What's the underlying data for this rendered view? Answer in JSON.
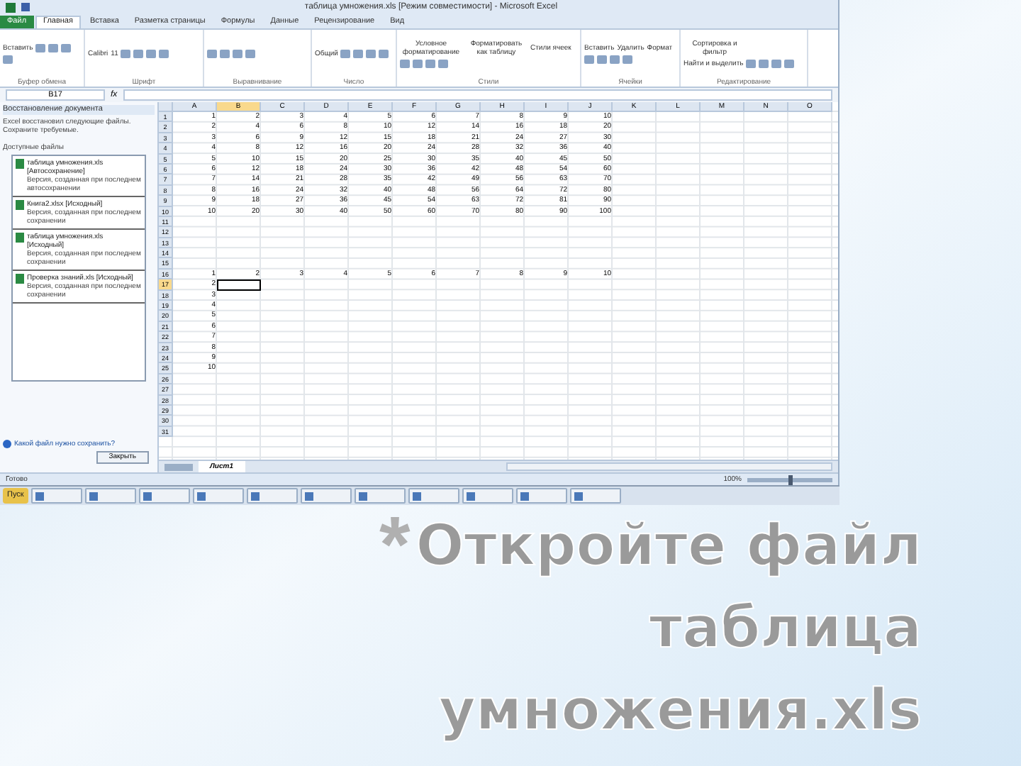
{
  "slide": {
    "bullet": "*",
    "title_lines": [
      "Откройте файл",
      "таблица",
      "умножения.xls"
    ]
  },
  "excel": {
    "title": "таблица умножения.xls [Режим совместимости] - Microsoft Excel",
    "ribbon_tabs": [
      {
        "label": "Файл",
        "selected": false,
        "kind": "file"
      },
      {
        "label": "Главная",
        "selected": true
      },
      {
        "label": "Вставка",
        "selected": false
      },
      {
        "label": "Разметка страницы",
        "selected": false
      },
      {
        "label": "Формулы",
        "selected": false
      },
      {
        "label": "Данные",
        "selected": false
      },
      {
        "label": "Рецензирование",
        "selected": false
      },
      {
        "label": "Вид",
        "selected": false
      }
    ],
    "ribbon_groups": [
      {
        "label": "Буфер обмена",
        "buttons": [
          "Вставить"
        ]
      },
      {
        "label": "Шрифт",
        "buttons": [
          "Calibri",
          "11"
        ]
      },
      {
        "label": "Выравнивание"
      },
      {
        "label": "Число",
        "buttons": [
          "Общий"
        ]
      },
      {
        "label": "Стили",
        "buttons": [
          "Условное форматирование",
          "Форматировать как таблицу",
          "Стили ячеек"
        ]
      },
      {
        "label": "Ячейки",
        "buttons": [
          "Вставить",
          "Удалить",
          "Формат"
        ]
      },
      {
        "label": "Редактирование",
        "buttons": [
          "Сортировка и фильтр",
          "Найти и выделить"
        ]
      }
    ],
    "name_box": "B17",
    "formula_symbol": "fx",
    "recovery_pane": {
      "title": "Восстановление документа",
      "message": "Excel восстановил следующие файлы. Сохраните требуемые.",
      "list_label": "Доступные файлы",
      "files": [
        {
          "name": "таблица умножения.xls [Автосохранение]",
          "version": "Версия, созданная при последнем автосохранении"
        },
        {
          "name": "Книга2.xlsx [Исходный]",
          "version": "Версия, созданная при последнем сохранении"
        },
        {
          "name": "таблица умножения.xls [Исходный]",
          "version": "Версия, созданная при последнем сохранении"
        },
        {
          "name": "Проверка знаний.xls [Исходный]",
          "version": "Версия, созданная при последнем сохранении"
        }
      ],
      "help_link": "Какой файл нужно сохранить?",
      "close_button": "Закрыть"
    },
    "columns": [
      {
        "label": "A",
        "selected": false
      },
      {
        "label": "B",
        "selected": true
      },
      {
        "label": "C",
        "selected": false
      },
      {
        "label": "D",
        "selected": false
      },
      {
        "label": "E",
        "selected": false
      },
      {
        "label": "F",
        "selected": false
      },
      {
        "label": "G",
        "selected": false
      },
      {
        "label": "H",
        "selected": false
      },
      {
        "label": "I",
        "selected": false
      },
      {
        "label": "J",
        "selected": false
      },
      {
        "label": "K",
        "selected": false
      },
      {
        "label": "L",
        "selected": false
      },
      {
        "label": "M",
        "selected": false
      },
      {
        "label": "N",
        "selected": false
      },
      {
        "label": "O",
        "selected": false
      }
    ],
    "rows": [
      {
        "number": "1",
        "selected": false,
        "cells": [
          "1",
          "2",
          "3",
          "4",
          "5",
          "6",
          "7",
          "8",
          "9",
          "10"
        ]
      },
      {
        "number": "2",
        "selected": false,
        "cells": [
          "2",
          "4",
          "6",
          "8",
          "10",
          "12",
          "14",
          "16",
          "18",
          "20"
        ]
      },
      {
        "number": "3",
        "selected": false,
        "cells": [
          "3",
          "6",
          "9",
          "12",
          "15",
          "18",
          "21",
          "24",
          "27",
          "30"
        ]
      },
      {
        "number": "4",
        "selected": false,
        "cells": [
          "4",
          "8",
          "12",
          "16",
          "20",
          "24",
          "28",
          "32",
          "36",
          "40"
        ]
      },
      {
        "number": "5",
        "selected": false,
        "cells": [
          "5",
          "10",
          "15",
          "20",
          "25",
          "30",
          "35",
          "40",
          "45",
          "50"
        ]
      },
      {
        "number": "6",
        "selected": false,
        "cells": [
          "6",
          "12",
          "18",
          "24",
          "30",
          "36",
          "42",
          "48",
          "54",
          "60"
        ]
      },
      {
        "number": "7",
        "selected": false,
        "cells": [
          "7",
          "14",
          "21",
          "28",
          "35",
          "42",
          "49",
          "56",
          "63",
          "70"
        ]
      },
      {
        "number": "8",
        "selected": false,
        "cells": [
          "8",
          "16",
          "24",
          "32",
          "40",
          "48",
          "56",
          "64",
          "72",
          "80"
        ]
      },
      {
        "number": "9",
        "selected": false,
        "cells": [
          "9",
          "18",
          "27",
          "36",
          "45",
          "54",
          "63",
          "72",
          "81",
          "90"
        ]
      },
      {
        "number": "10",
        "selected": false,
        "cells": [
          "10",
          "20",
          "30",
          "40",
          "50",
          "60",
          "70",
          "80",
          "90",
          "100"
        ]
      },
      {
        "number": "11",
        "selected": false
      },
      {
        "number": "12",
        "selected": false
      },
      {
        "number": "13",
        "selected": false
      },
      {
        "number": "14",
        "selected": false
      },
      {
        "number": "15",
        "selected": false
      },
      {
        "number": "16",
        "selected": false,
        "cells": [
          "1",
          "2",
          "3",
          "4",
          "5",
          "6",
          "7",
          "8",
          "9",
          "10"
        ]
      },
      {
        "number": "17",
        "selected": true,
        "cells": [
          "2"
        ]
      },
      {
        "number": "18",
        "selected": false,
        "cells": [
          "3"
        ]
      },
      {
        "number": "19",
        "selected": false,
        "cells": [
          "4"
        ]
      },
      {
        "number": "20",
        "selected": false,
        "cells": [
          "5"
        ]
      },
      {
        "number": "21",
        "selected": false,
        "cells": [
          "6"
        ]
      },
      {
        "number": "22",
        "selected": false,
        "cells": [
          "7"
        ]
      },
      {
        "number": "23",
        "selected": false,
        "cells": [
          "8"
        ]
      },
      {
        "number": "24",
        "selected": false,
        "cells": [
          "9"
        ]
      },
      {
        "number": "25",
        "selected": false,
        "cells": [
          "10"
        ]
      },
      {
        "number": "26",
        "selected": false
      },
      {
        "number": "27",
        "selected": false
      },
      {
        "number": "28",
        "selected": false
      },
      {
        "number": "29",
        "selected": false
      },
      {
        "number": "30",
        "selected": false
      },
      {
        "number": "31",
        "selected": false
      }
    ],
    "sheet_tabs": [
      {
        "label": "Лист1",
        "selected": true
      }
    ],
    "status": "Готово",
    "zoom": "100%",
    "zoom_slider": {
      "level": 0.5
    }
  },
  "taskbar": {
    "start": "Пуск"
  }
}
